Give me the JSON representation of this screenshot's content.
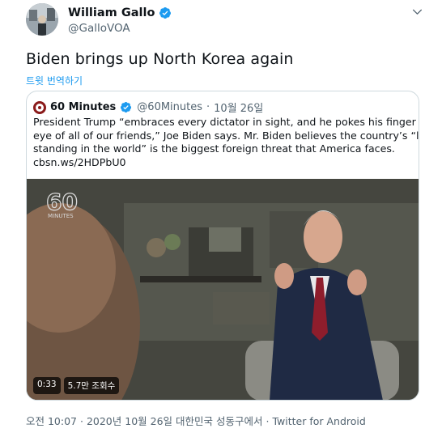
{
  "author": {
    "display_name": "William Gallo",
    "handle": "@GalloVOA",
    "avatar_icon": "user-avatar"
  },
  "tweet": {
    "text": "Biden brings up North Korea again",
    "translate_label": "트윗 번역하기"
  },
  "quote": {
    "display_name": "60 Minutes",
    "handle": "@60Minutes",
    "separator": "·",
    "date": "10월 26일",
    "lines": [
      "President Trump “embraces every dictator in sight, and he pokes his finger in the",
      "eye of all of our friends,” Joe Biden says. Mr. Biden believes the country’s “lack of",
      "standing in the world” is the biggest foreign threat that America faces.",
      "cbsn.ws/2HDPbU0"
    ],
    "video": {
      "watermark": "60",
      "watermark_sub": "MINUTES",
      "duration": "0:33",
      "views": "5.7만 조회수"
    }
  },
  "footer": {
    "time": "오전 10:07",
    "date": "2020년 10월 26일",
    "location": "대한민국 성동구에서",
    "app": "Twitter for Android",
    "dot": "·"
  },
  "colors": {
    "link": "#1d9bf0",
    "verified": "#1d9bf0",
    "muted": "#536471"
  }
}
